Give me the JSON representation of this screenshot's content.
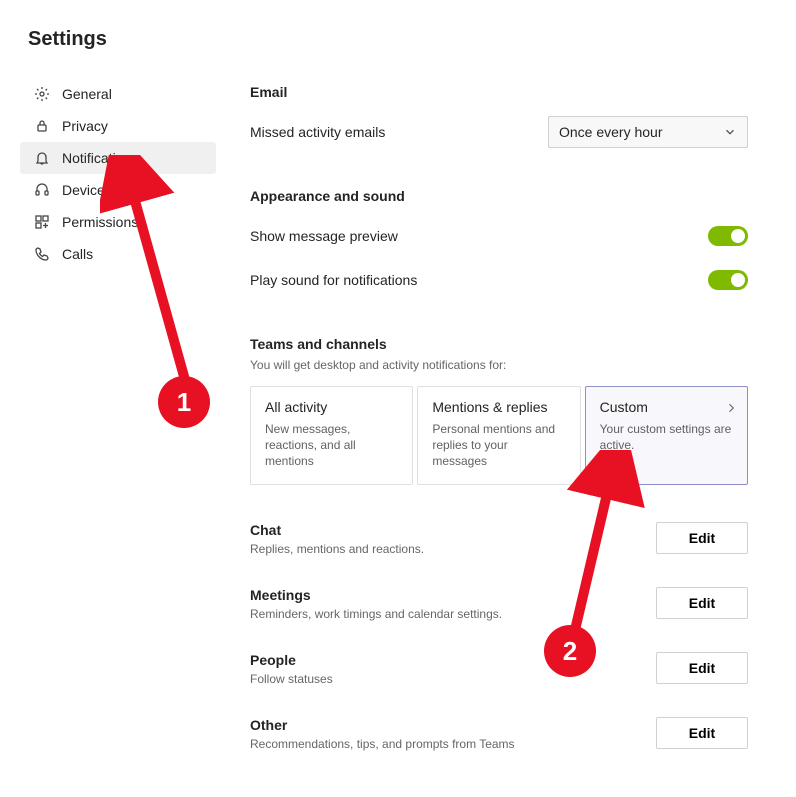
{
  "header": {
    "title": "Settings"
  },
  "sidebar": {
    "items": [
      {
        "label": "General",
        "icon": "gear-icon"
      },
      {
        "label": "Privacy",
        "icon": "lock-icon"
      },
      {
        "label": "Notifications",
        "icon": "bell-icon"
      },
      {
        "label": "Devices",
        "icon": "headset-icon"
      },
      {
        "label": "Permissions",
        "icon": "apps-icon"
      },
      {
        "label": "Calls",
        "icon": "phone-icon"
      }
    ],
    "active_index": 2
  },
  "email": {
    "section_title": "Email",
    "missed_label": "Missed activity emails",
    "missed_value": "Once every hour"
  },
  "appearance": {
    "section_title": "Appearance and sound",
    "preview_label": "Show message preview",
    "preview_on": true,
    "sound_label": "Play sound for notifications",
    "sound_on": true
  },
  "teams": {
    "section_title": "Teams and channels",
    "subtitle": "You will get desktop and activity notifications for:",
    "cards": [
      {
        "title": "All activity",
        "desc": "New messages, reactions, and all mentions"
      },
      {
        "title": "Mentions & replies",
        "desc": "Personal mentions and replies to your messages"
      },
      {
        "title": "Custom",
        "desc": "Your custom settings are active."
      }
    ],
    "selected_index": 2
  },
  "sections": [
    {
      "title": "Chat",
      "desc": "Replies, mentions and reactions.",
      "button": "Edit"
    },
    {
      "title": "Meetings",
      "desc": "Reminders, work timings and calendar settings.",
      "button": "Edit"
    },
    {
      "title": "People",
      "desc": "Follow statuses",
      "button": "Edit"
    },
    {
      "title": "Other",
      "desc": "Recommendations, tips, and prompts from Teams",
      "button": "Edit"
    }
  ],
  "annotations": {
    "one": "1",
    "two": "2"
  }
}
